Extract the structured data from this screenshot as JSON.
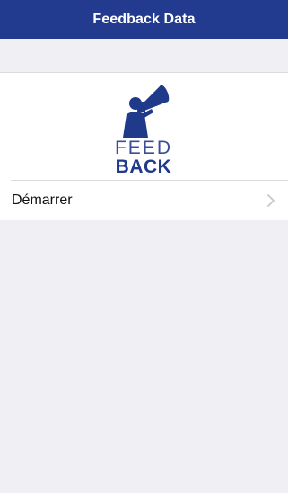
{
  "navbar": {
    "title": "Feedback Data"
  },
  "logo": {
    "line1": "FEED",
    "line2": "BACK",
    "icon": "megaphone-person-icon"
  },
  "menu": {
    "items": [
      {
        "label": "Démarrer",
        "icon": "chevron-right-icon"
      }
    ]
  },
  "colors": {
    "navbar": "#223b8f",
    "logo": "#1f3a8a",
    "background": "#efeff4"
  }
}
